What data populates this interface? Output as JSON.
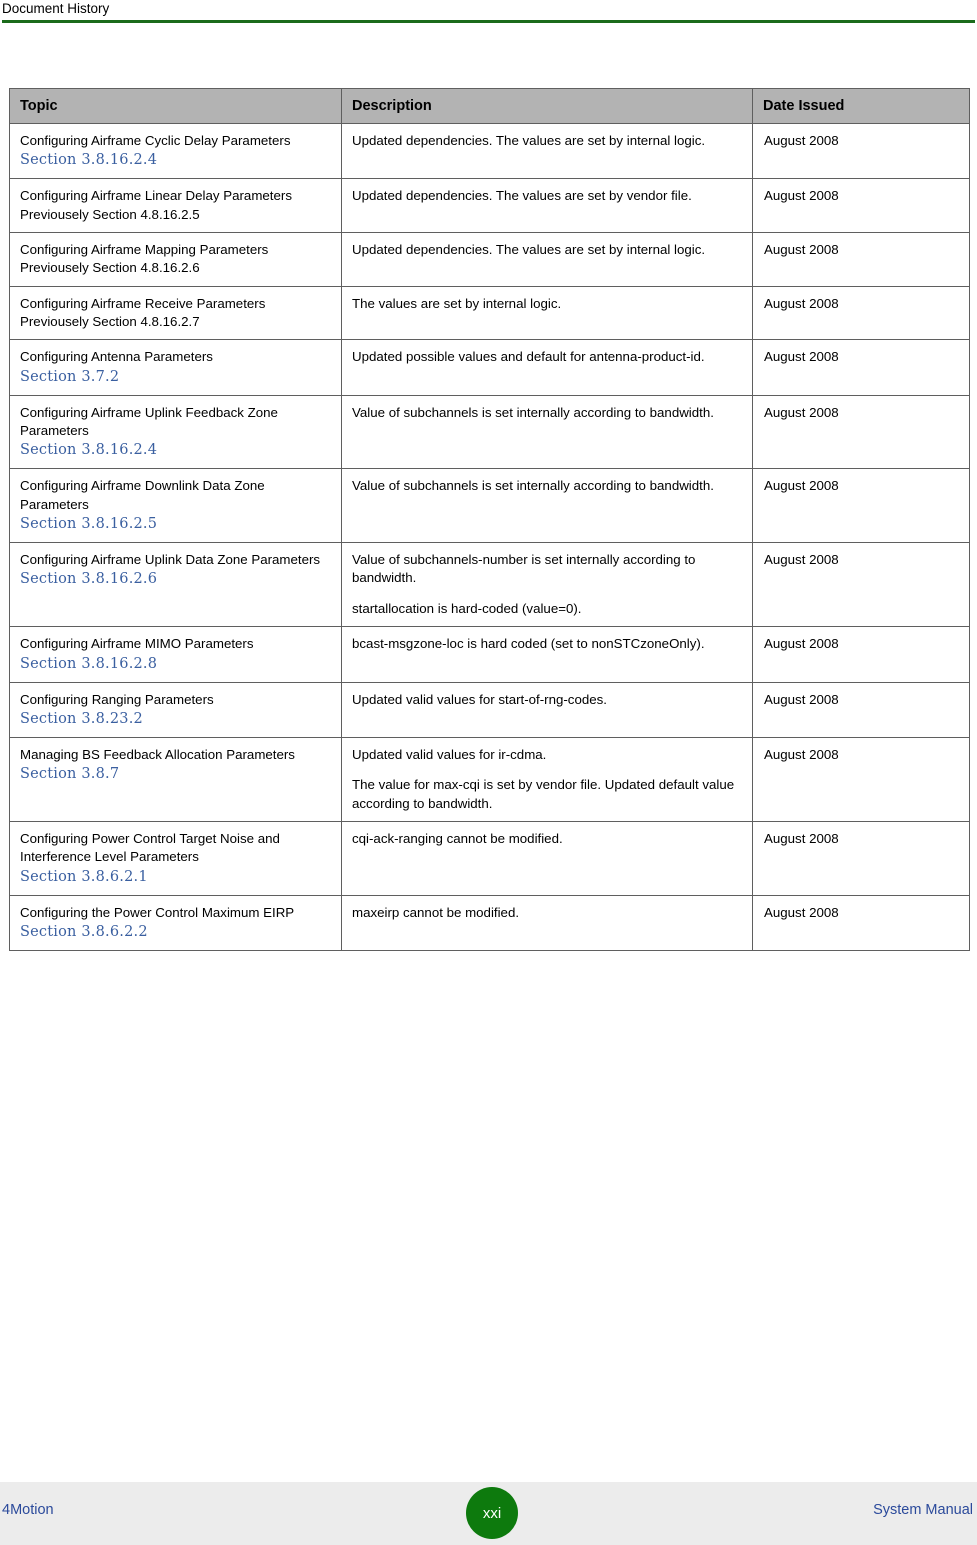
{
  "header": {
    "title": "Document History"
  },
  "table": {
    "columns": [
      "Topic",
      "Description",
      "Date Issued"
    ],
    "rows": [
      {
        "topic": "Configuring Airframe Cyclic Delay Parameters",
        "section": "Section 3.8.16.2.4",
        "previously": "",
        "description": [
          "Updated dependencies. The values are set by internal logic."
        ],
        "date": "August 2008"
      },
      {
        "topic": "Configuring Airframe Linear Delay Parameters",
        "section": "",
        "previously": "Previousely Section 4.8.16.2.5",
        "description": [
          "Updated dependencies. The values are set by vendor file."
        ],
        "date": "August 2008"
      },
      {
        "topic": "Configuring Airframe Mapping Parameters",
        "section": "",
        "previously": "Previousely Section 4.8.16.2.6",
        "description": [
          "Updated dependencies. The values are set by internal logic."
        ],
        "date": "August 2008"
      },
      {
        "topic": "Configuring Airframe Receive Parameters",
        "section": "",
        "previously": "Previousely Section 4.8.16.2.7",
        "description": [
          "The values are set by internal logic."
        ],
        "date": "August 2008"
      },
      {
        "topic": "Configuring Antenna Parameters",
        "section": "Section 3.7.2",
        "previously": "",
        "description": [
          "Updated possible values and default for antenna-product-id."
        ],
        "date": "August 2008"
      },
      {
        "topic": "Configuring Airframe Uplink Feedback Zone Parameters",
        "section": "Section 3.8.16.2.4",
        "previously": "",
        "description": [
          "Value of subchannels is set internally according to bandwidth."
        ],
        "date": "August 2008"
      },
      {
        "topic": "Configuring Airframe Downlink Data Zone Parameters",
        "section": "Section 3.8.16.2.5",
        "previously": "",
        "description": [
          "Value of subchannels is set internally according to bandwidth."
        ],
        "date": "August 2008"
      },
      {
        "topic": "Configuring Airframe Uplink Data Zone Parameters",
        "section": "Section 3.8.16.2.6",
        "previously": "",
        "description": [
          "Value of subchannels-number is set internally according to bandwidth.",
          "startallocation is hard-coded (value=0)."
        ],
        "date": "August 2008"
      },
      {
        "topic": "Configuring Airframe MIMO Parameters",
        "section": "Section 3.8.16.2.8",
        "previously": "",
        "description": [
          "bcast-msgzone-loc is hard coded (set to nonSTCzoneOnly)."
        ],
        "date": "August 2008"
      },
      {
        "topic": "Configuring Ranging Parameters",
        "section": "Section 3.8.23.2",
        "previously": "",
        "description": [
          "Updated valid values for start-of-rng-codes."
        ],
        "date": "August 2008"
      },
      {
        "topic": "Managing BS Feedback Allocation Parameters",
        "section": "Section 3.8.7",
        "previously": "",
        "description": [
          "Updated valid values for ir-cdma.",
          "The value for max-cqi is set by vendor file. Updated default value according to bandwidth."
        ],
        "date": "August 2008"
      },
      {
        "topic": "Configuring Power Control Target Noise and Interference Level Parameters",
        "section": "Section 3.8.6.2.1",
        "previously": "",
        "description": [
          "cqi-ack-ranging cannot be modified."
        ],
        "date": "August 2008"
      },
      {
        "topic": "Configuring the Power Control Maximum EIRP",
        "section": "Section 3.8.6.2.2",
        "previously": "",
        "description": [
          "maxeirp cannot be modified."
        ],
        "date": "August 2008"
      }
    ]
  },
  "footer": {
    "left": "4Motion",
    "page": "xxi",
    "right": "System Manual"
  },
  "colors": {
    "header_rule": "#1b6b1b",
    "link": "#3a5fa0",
    "footer_text": "#2b4a9b",
    "table_header_bg": "#b3b3b3",
    "badge_bg": "#0d7a0d"
  }
}
